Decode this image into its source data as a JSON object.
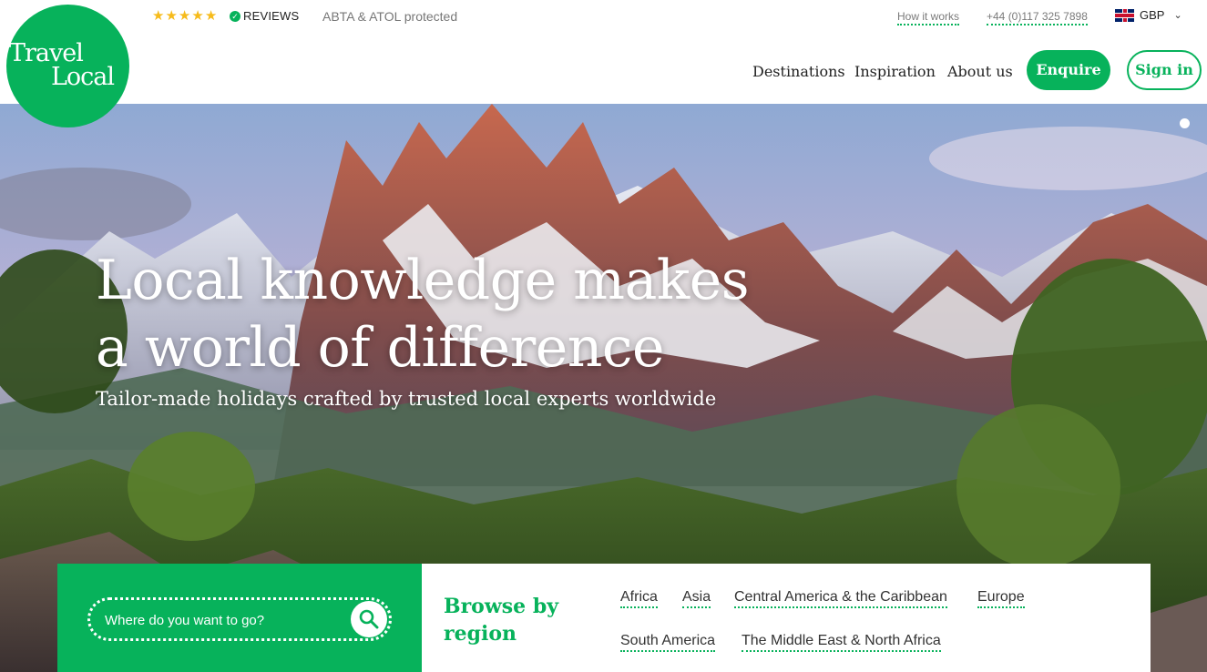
{
  "brand": {
    "line1": "Travel",
    "line2": "Local",
    "color": "#07b25b"
  },
  "topbar": {
    "stars": [
      "★",
      "★",
      "★",
      "★",
      "★"
    ],
    "reviews_label": "REVIEWS",
    "reviews_icon": "check-star-icon",
    "abta": "ABTA & ATOL protected",
    "how_it_works": "How it works",
    "phone": "+44 (0)117 325 7898",
    "currency": "GBP",
    "currency_flag": "uk-flag-icon"
  },
  "nav": {
    "destinations": "Destinations",
    "inspiration": "Inspiration",
    "about": "About us",
    "enquire": "Enquire",
    "signin": "Sign in"
  },
  "hero": {
    "title_line1": "Local knowledge makes",
    "title_line2": "a world of difference",
    "subtitle": "Tailor-made holidays crafted by trusted local experts worldwide"
  },
  "search": {
    "placeholder": "Where do you want to go?",
    "icon": "search-icon"
  },
  "browse": {
    "title": "Browse by region",
    "regions": [
      "Africa",
      "Asia",
      "Central America & the Caribbean",
      "Europe",
      "South America",
      "The Middle East & North Africa"
    ]
  }
}
